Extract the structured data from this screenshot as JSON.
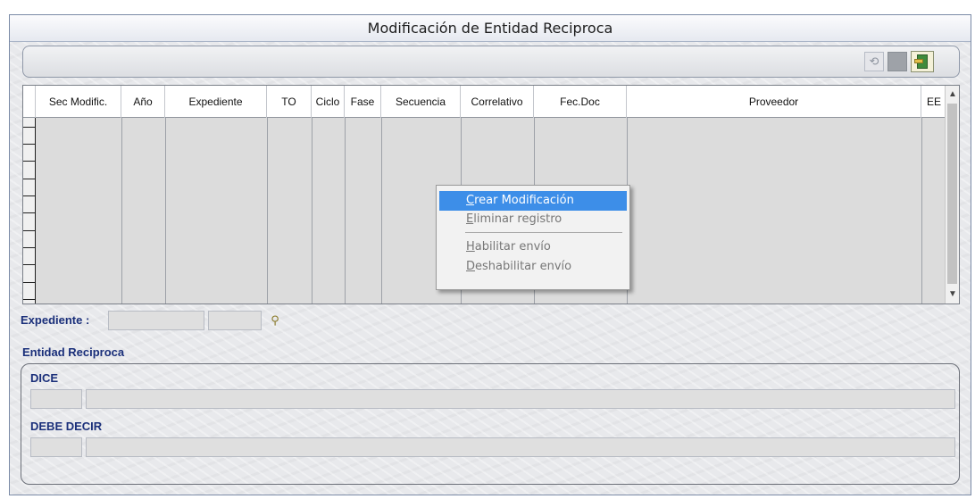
{
  "window": {
    "title": "Modificación de Entidad Reciproca"
  },
  "toolbar": {
    "undo_icon": "undo-icon",
    "exit_icon": "exit-door-icon"
  },
  "grid": {
    "columns": [
      "Sec Modific.",
      "Año",
      "Expediente",
      "TO",
      "Ciclo",
      "Fase",
      "Secuencia",
      "Correlativo",
      "Fec.Doc",
      "Proveedor",
      "EE"
    ],
    "rows": []
  },
  "context_menu": {
    "items": [
      {
        "label": "Crear Modificación",
        "underline": "C",
        "enabled": true,
        "highlighted": true
      },
      {
        "label": "Eliminar registro",
        "underline": "E",
        "enabled": false
      },
      {
        "label": "Habilitar envío",
        "underline": "H",
        "enabled": false
      },
      {
        "label": "Deshabilitar envío",
        "underline": "D",
        "enabled": false
      }
    ]
  },
  "form": {
    "expediente_label": "Expediente :",
    "section_title": "Entidad Reciproca",
    "dice_label": "DICE",
    "debe_decir_label": "DEBE DECIR"
  }
}
